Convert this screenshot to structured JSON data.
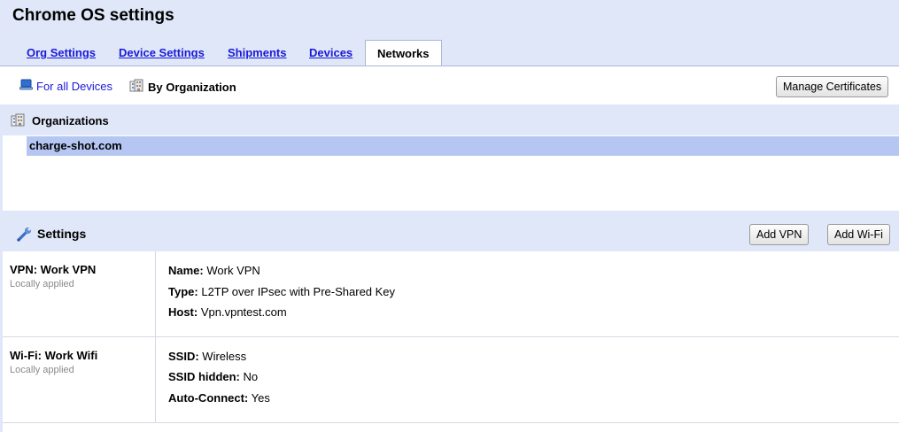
{
  "page": {
    "title": "Chrome OS settings"
  },
  "tabs": [
    {
      "label": "Org Settings",
      "active": false
    },
    {
      "label": "Device Settings",
      "active": false
    },
    {
      "label": "Shipments",
      "active": false
    },
    {
      "label": "Devices",
      "active": false
    },
    {
      "label": "Networks",
      "active": true
    }
  ],
  "subnav": {
    "all_devices": {
      "label": "For all Devices",
      "icon": "device-icon"
    },
    "by_org": {
      "label": "By Organization",
      "icon": "organization-icon"
    },
    "manage_certificates": "Manage Certificates"
  },
  "organizations": {
    "title": "Organizations",
    "icon": "organization-icon",
    "items": [
      {
        "label": "charge-shot.com",
        "selected": true
      }
    ]
  },
  "settings": {
    "title": "Settings",
    "icon": "wrench-icon",
    "add_vpn": "Add VPN",
    "add_wifi": "Add Wi-Fi",
    "networks": [
      {
        "name": "VPN: Work VPN",
        "status": "Locally applied",
        "fields": [
          {
            "key": "Name:",
            "value": "Work VPN"
          },
          {
            "key": "Type:",
            "value": "L2TP over IPsec with Pre-Shared Key"
          },
          {
            "key": "Host:",
            "value": "Vpn.vpntest.com"
          }
        ]
      },
      {
        "name": "Wi-Fi: Work Wifi",
        "status": "Locally applied",
        "fields": [
          {
            "key": "SSID:",
            "value": "Wireless"
          },
          {
            "key": "SSID hidden:",
            "value": "No"
          },
          {
            "key": "Auto-Connect:",
            "value": "Yes"
          }
        ]
      }
    ]
  },
  "colors": {
    "header_bg": "#dfe7f8",
    "selected_row": "#b4c6f1",
    "link": "#1a1ad8"
  }
}
